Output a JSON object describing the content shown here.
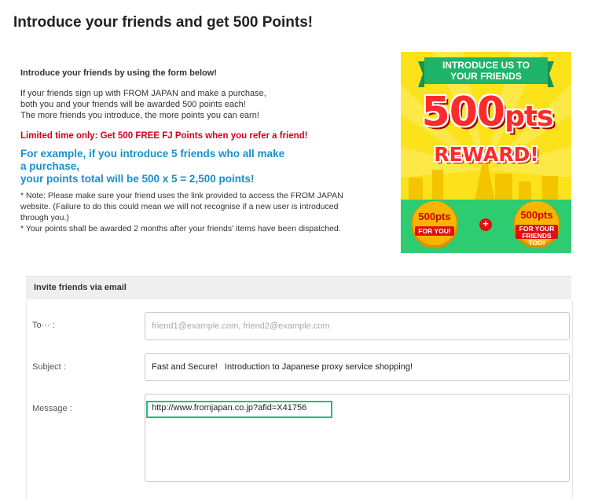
{
  "page": {
    "title": "Introduce your friends and get 500 Points!"
  },
  "intro": {
    "lead": "Introduce your friends by using the form below!",
    "body": "If your friends sign up with FROM JAPAN and make a purchase,\nboth you and your friends will be awarded 500 points each!\nThe more friends you introduce, the more points you can earn!",
    "limited": "Limited time only: Get 500 FREE FJ Points when you refer a friend!",
    "example": "For example, if you introduce 5 friends who all make\na purchase,\nyour points total will be 500 x 5 = 2,500 points!",
    "notes": "* Note: Please make sure your friend uses the link provided to access the FROM JAPAN\nwebsite. (Failure to do this could mean we will not recognise if a new user is introduced\nthrough you.)\n* Your points shall be awarded 2 months after your friends' items have been dispatched."
  },
  "banner": {
    "heading_line1": "INTRODUCE US TO",
    "heading_line2": "YOUR FRIENDS",
    "big_number": "500",
    "big_unit": "pts",
    "reward": "REWARD!",
    "coin_left_value": "500pts",
    "coin_left_tag": "FOR YOU!",
    "plus": "+",
    "coin_right_value": "500pts",
    "coin_right_tag_line1": "FOR YOUR",
    "coin_right_tag_line2": "FRIENDS TOO!",
    "colors": {
      "background": "#fbe21b",
      "green": "#2ecc71",
      "red": "#ff2b2b",
      "coin": "#f7b500"
    }
  },
  "form": {
    "header": "Invite friends via email",
    "to_label": "To··· :",
    "to_placeholder": "friend1@example.com, friend2@example.com",
    "to_value": "",
    "subject_label": "Subject :",
    "subject_value": "Fast and Secure!   Introduction to Japanese proxy service shopping!",
    "message_label": "Message :",
    "message_value": "http://www.fromjapan.co.jp?afid=X41756",
    "highlight_color": "#1cc07a"
  }
}
